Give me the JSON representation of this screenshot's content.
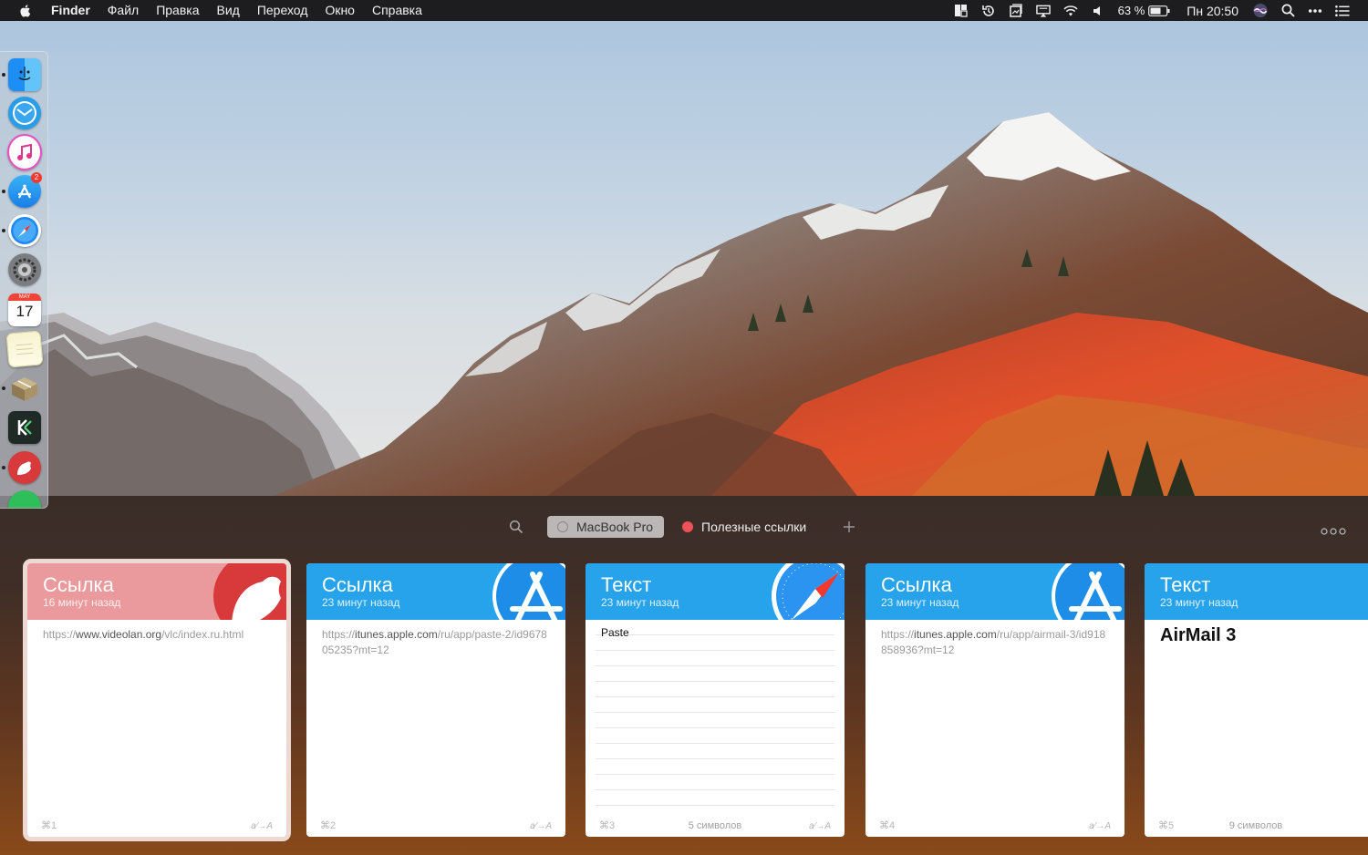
{
  "menubar": {
    "app_name": "Finder",
    "menus": [
      "Файл",
      "Правка",
      "Вид",
      "Переход",
      "Окно",
      "Справка"
    ],
    "battery": "63 %",
    "datetime": "Пн 20:50"
  },
  "dock": {
    "calendar_month": "MAY",
    "calendar_day": "17",
    "appstore_badge": "2"
  },
  "panel": {
    "pinboards": [
      {
        "label": "MacBook Pro",
        "active": true
      },
      {
        "label": "Полезные ссылки",
        "color": "#f0525a"
      }
    ],
    "cards": [
      {
        "title": "Ссылка",
        "time": "16 минут назад",
        "header_color": "#ea9a9c",
        "url_scheme": "https://",
        "url_host": "www.videolan.org",
        "url_path": "/vlc/index.ru.html",
        "shortcut": "⌘1",
        "fmt": "a⁄→A",
        "app": "bear-icon"
      },
      {
        "title": "Ссылка",
        "time": "23 минут назад",
        "header_color": "#27a3ec",
        "url_scheme": "https://",
        "url_host": "itunes.apple.com",
        "url_path": "/ru/app/paste-2/id967805235?mt=12",
        "shortcut": "⌘2",
        "fmt": "a⁄→A",
        "app": "appstore-icon"
      },
      {
        "title": "Текст",
        "time": "23 минут назад",
        "header_color": "#27a3ec",
        "text": "Paste",
        "chars": "5 символов",
        "shortcut": "⌘3",
        "fmt": "a⁄→A",
        "app": "safari-icon"
      },
      {
        "title": "Ссылка",
        "time": "23 минут назад",
        "header_color": "#27a3ec",
        "url_scheme": "https://",
        "url_host": "itunes.apple.com",
        "url_path": "/ru/app/airmail-3/id918858936?mt=12",
        "shortcut": "⌘4",
        "fmt": "a⁄→A",
        "app": "appstore-icon"
      },
      {
        "title": "Текст",
        "time": "23 минут назад",
        "header_color": "#27a3ec",
        "text": "AirMail 3",
        "chars": "9 символов",
        "shortcut": "⌘5",
        "app": "safari-icon"
      }
    ]
  },
  "colors": {
    "menubar_bg": "#1d1d1f",
    "panel_bg": "#3f2e27",
    "accent_blue": "#27a3ec",
    "accent_pink": "#ea9a9c"
  }
}
